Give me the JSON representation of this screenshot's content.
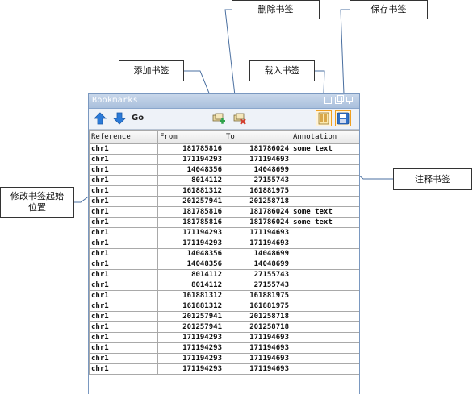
{
  "callouts": {
    "delete": "删除书签",
    "save": "保存书签",
    "add": "添加书签",
    "load": "载入书签",
    "edit": "修改书签起始位置",
    "note": "注释书签"
  },
  "panel": {
    "title": "Bookmarks",
    "go_label": "Go"
  },
  "icons": {
    "up": "arrow-up-icon",
    "down": "arrow-down-icon",
    "add": "add-bookmark-icon",
    "delete": "delete-bookmark-icon",
    "load": "load-bookmarks-icon",
    "save": "save-bookmarks-icon"
  },
  "colors": {
    "arrow": "#2b7ad8",
    "add": "#2fa24a",
    "delete": "#d23b2b",
    "title_bar": "#a9bfdc"
  },
  "table": {
    "columns": [
      "Reference",
      "From",
      "To",
      "Annotation"
    ],
    "rows": [
      [
        "chr1",
        "181785816",
        "181786024",
        "some text"
      ],
      [
        "chr1",
        "171194293",
        "171194693",
        ""
      ],
      [
        "chr1",
        "14048356",
        "14048699",
        ""
      ],
      [
        "chr1",
        "8014112",
        "27155743",
        ""
      ],
      [
        "chr1",
        "161881312",
        "161881975",
        ""
      ],
      [
        "chr1",
        "201257941",
        "201258718",
        ""
      ],
      [
        "chr1",
        "181785816",
        "181786024",
        "some text"
      ],
      [
        "chr1",
        "181785816",
        "181786024",
        "some text"
      ],
      [
        "chr1",
        "171194293",
        "171194693",
        ""
      ],
      [
        "chr1",
        "171194293",
        "171194693",
        ""
      ],
      [
        "chr1",
        "14048356",
        "14048699",
        ""
      ],
      [
        "chr1",
        "14048356",
        "14048699",
        ""
      ],
      [
        "chr1",
        "8014112",
        "27155743",
        ""
      ],
      [
        "chr1",
        "8014112",
        "27155743",
        ""
      ],
      [
        "chr1",
        "161881312",
        "161881975",
        ""
      ],
      [
        "chr1",
        "161881312",
        "161881975",
        ""
      ],
      [
        "chr1",
        "201257941",
        "201258718",
        ""
      ],
      [
        "chr1",
        "201257941",
        "201258718",
        ""
      ],
      [
        "chr1",
        "171194293",
        "171194693",
        ""
      ],
      [
        "chr1",
        "171194293",
        "171194693",
        ""
      ],
      [
        "chr1",
        "171194293",
        "171194693",
        ""
      ],
      [
        "chr1",
        "171194293",
        "171194693",
        ""
      ]
    ]
  }
}
